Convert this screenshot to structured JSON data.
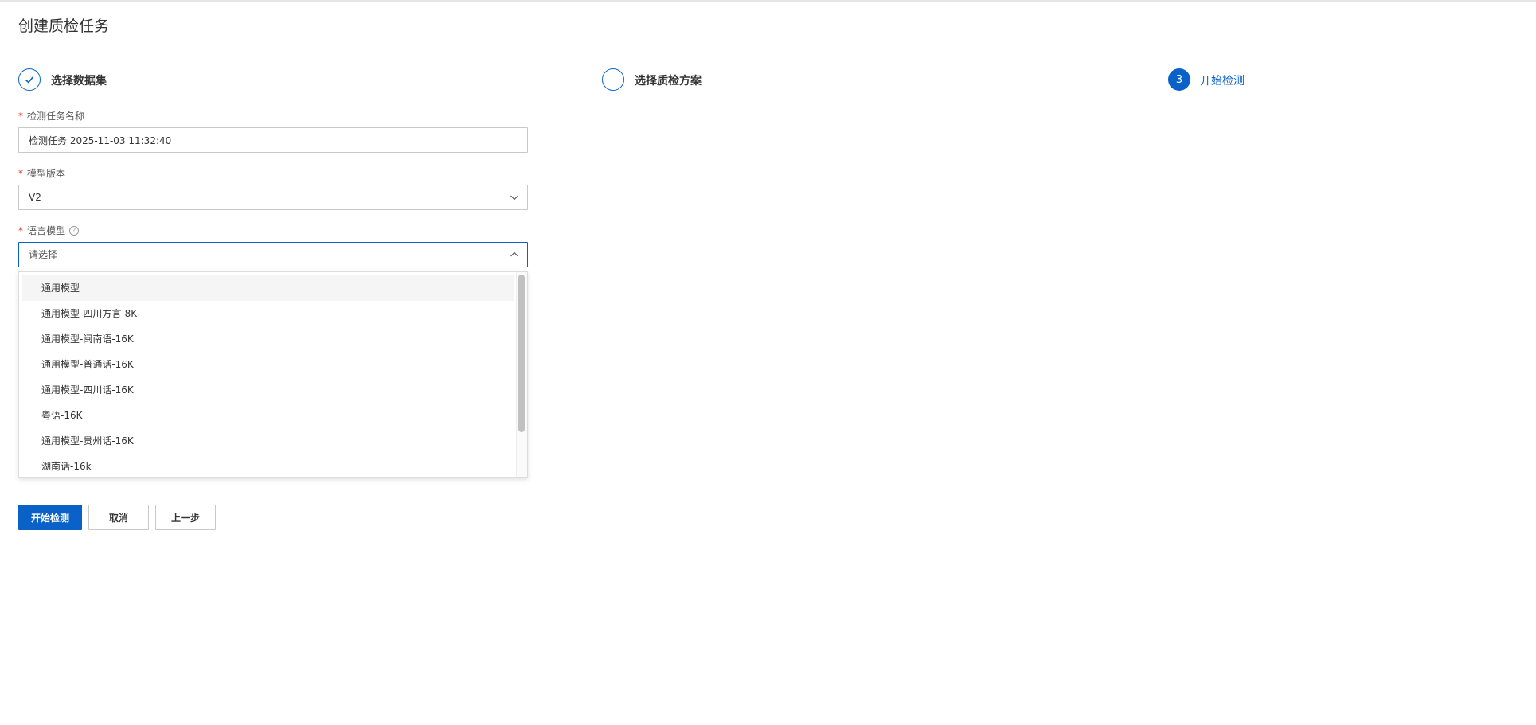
{
  "header": {
    "title": "创建质检任务"
  },
  "steps": [
    {
      "label": "选择数据集",
      "state": "done",
      "icon": "check-icon"
    },
    {
      "label": "选择质检方案",
      "state": "pending"
    },
    {
      "label": "开始检测",
      "state": "active",
      "number": "3"
    }
  ],
  "form": {
    "task_name": {
      "label": "检测任务名称",
      "value": "检测任务 2025-11-03 11:32:40"
    },
    "model_version": {
      "label": "模型版本",
      "value": "V2"
    },
    "language_model": {
      "label": "语言模型",
      "placeholder": "请选择",
      "help_icon": "question-circle-icon"
    }
  },
  "dropdown": {
    "options": [
      "通用模型",
      "通用模型-四川方言-8K",
      "通用模型-闽南语-16K",
      "通用模型-普通话-16K",
      "通用模型-四川话-16K",
      "粤语-16K",
      "通用模型-贵州话-16K",
      "湖南话-16k"
    ]
  },
  "buttons": {
    "start": "开始检测",
    "cancel": "取消",
    "prev": "上一步"
  },
  "colors": {
    "primary": "#0a62c9",
    "required": "#d93026"
  }
}
